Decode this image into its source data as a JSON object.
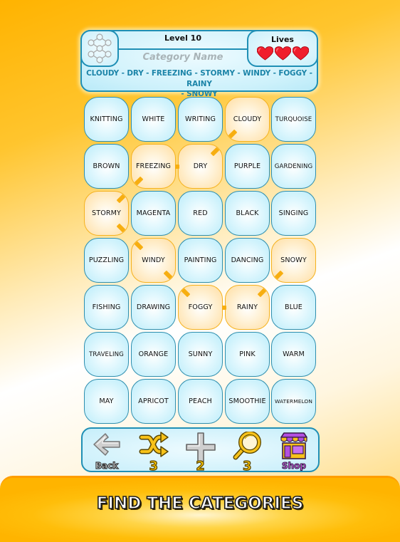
{
  "header": {
    "level_label": "Level 10",
    "category_placeholder": "Category Name",
    "lives_label": "Lives",
    "lives_count": 3,
    "lives_max": 3,
    "found_words_line1": "CLOUDY - DRY - FREEZING - STORMY - WINDY - FOGGY - RAINY",
    "found_words_line2": "- SNOWY",
    "icon": "network-icon"
  },
  "grid": {
    "rows": [
      [
        {
          "word": "KNITTING",
          "selected": false
        },
        {
          "word": "WHITE",
          "selected": false
        },
        {
          "word": "WRITING",
          "selected": false
        },
        {
          "word": "CLOUDY",
          "selected": true
        },
        {
          "word": "TURQUOISE",
          "selected": false
        }
      ],
      [
        {
          "word": "BROWN",
          "selected": false
        },
        {
          "word": "FREEZING",
          "selected": true
        },
        {
          "word": "DRY",
          "selected": true
        },
        {
          "word": "PURPLE",
          "selected": false
        },
        {
          "word": "GARDENING",
          "selected": false
        }
      ],
      [
        {
          "word": "STORMY",
          "selected": true
        },
        {
          "word": "MAGENTA",
          "selected": false
        },
        {
          "word": "RED",
          "selected": false
        },
        {
          "word": "BLACK",
          "selected": false
        },
        {
          "word": "SINGING",
          "selected": false
        }
      ],
      [
        {
          "word": "PUZZLING",
          "selected": false
        },
        {
          "word": "WINDY",
          "selected": true
        },
        {
          "word": "PAINTING",
          "selected": false
        },
        {
          "word": "DANCING",
          "selected": false
        },
        {
          "word": "SNOWY",
          "selected": true
        }
      ],
      [
        {
          "word": "FISHING",
          "selected": false
        },
        {
          "word": "DRAWING",
          "selected": false
        },
        {
          "word": "FOGGY",
          "selected": true
        },
        {
          "word": "RAINY",
          "selected": true
        },
        {
          "word": "BLUE",
          "selected": false
        }
      ],
      [
        {
          "word": "TRAVELING",
          "selected": false
        },
        {
          "word": "ORANGE",
          "selected": false
        },
        {
          "word": "SUNNY",
          "selected": false
        },
        {
          "word": "PINK",
          "selected": false
        },
        {
          "word": "WARM",
          "selected": false
        }
      ],
      [
        {
          "word": "MAY",
          "selected": false
        },
        {
          "word": "APRICOT",
          "selected": false
        },
        {
          "word": "PEACH",
          "selected": false
        },
        {
          "word": "SMOOTHIE",
          "selected": false
        },
        {
          "word": "WATERMELON",
          "selected": false
        }
      ]
    ],
    "selection_path": [
      "CLOUDY",
      "DRY",
      "FREEZING",
      "STORMY",
      "WINDY",
      "FOGGY",
      "RAINY",
      "SNOWY"
    ],
    "colors": {
      "tile_border": "#2E8EAE",
      "selected_border": "#F5B21E",
      "connector": "#F7AE10"
    }
  },
  "toolbar": {
    "back_label": "Back",
    "shuffle_count": "3",
    "add_count": "2",
    "hint_count": "3",
    "shop_label": "Shop"
  },
  "banner": {
    "text": "FIND THE CATEGORIES"
  }
}
